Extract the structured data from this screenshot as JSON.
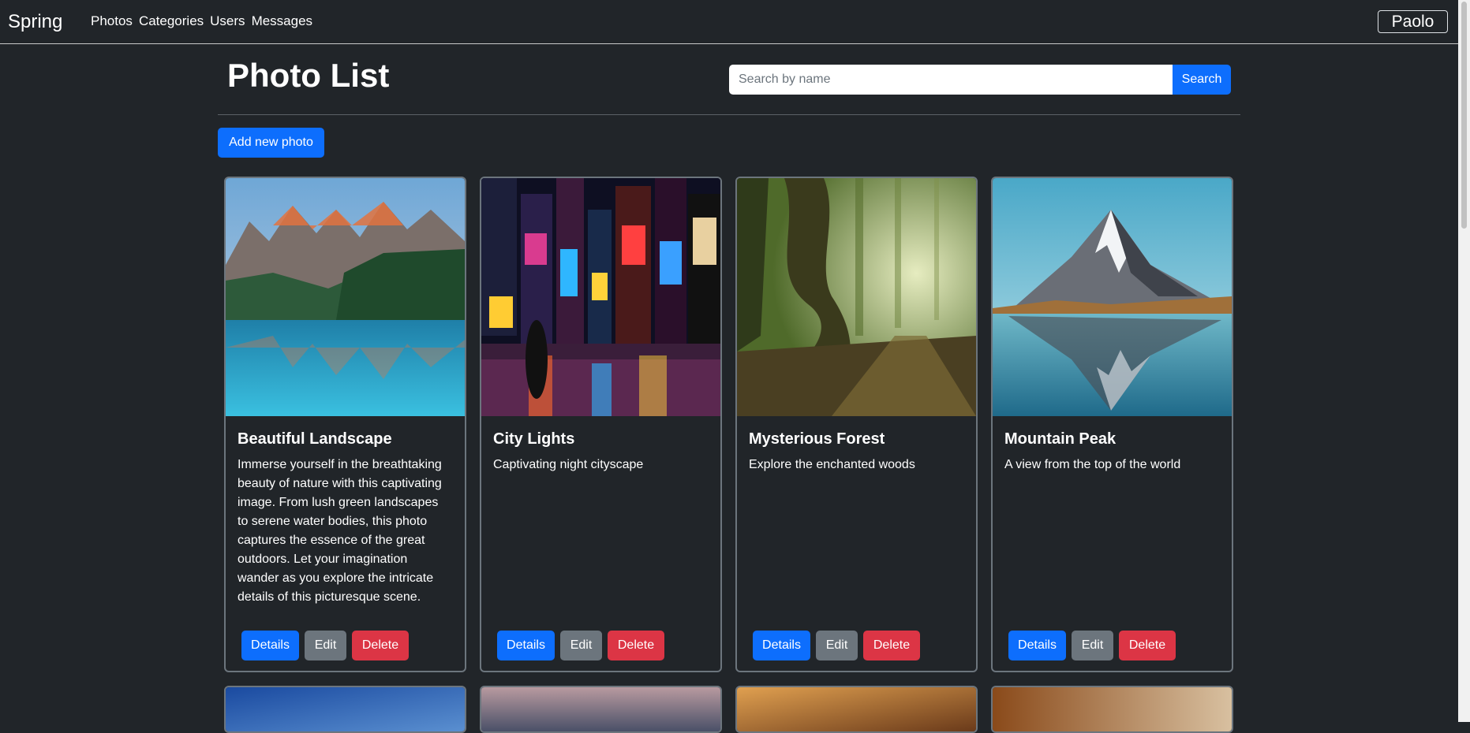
{
  "navbar": {
    "brand": "Spring",
    "links": [
      "Photos",
      "Categories",
      "Users",
      "Messages"
    ],
    "user": "Paolo"
  },
  "page": {
    "title": "Photo List",
    "add_button": "Add new photo"
  },
  "search": {
    "placeholder": "Search by name",
    "value": "",
    "button": "Search"
  },
  "photos": [
    {
      "title": "Beautiful Landscape",
      "description": "Immerse yourself in the breathtaking beauty of nature with this captivating image. From lush green landscapes to serene water bodies, this photo captures the essence of the great outdoors. Let your imagination wander as you explore the intricate details of this picturesque scene.",
      "details_label": "Details",
      "edit_label": "Edit",
      "delete_label": "Delete"
    },
    {
      "title": "City Lights",
      "description": "Captivating night cityscape",
      "details_label": "Details",
      "edit_label": "Edit",
      "delete_label": "Delete"
    },
    {
      "title": "Mysterious Forest",
      "description": "Explore the enchanted woods",
      "details_label": "Details",
      "edit_label": "Edit",
      "delete_label": "Delete"
    },
    {
      "title": "Mountain Peak",
      "description": "A view from the top of the world",
      "details_label": "Details",
      "edit_label": "Edit",
      "delete_label": "Delete"
    }
  ],
  "colors": {
    "background": "#212529",
    "primary": "#0d6efd",
    "secondary": "#6c757d",
    "danger": "#dc3545"
  }
}
